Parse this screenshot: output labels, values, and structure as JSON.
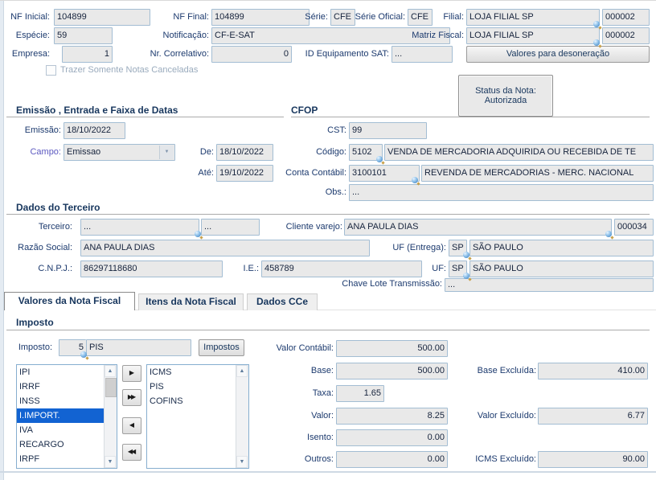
{
  "colors": {
    "label": "#1c3a6e",
    "field_bg": "#e9e9e9",
    "field_border": "#a3bdd3",
    "selection_blue": "#1263d2",
    "disabled_text": "#9aabbd"
  },
  "top": {
    "nf_inicial": {
      "label": "NF Inicial:",
      "value": "104899"
    },
    "nf_final": {
      "label": "NF Final:",
      "value": "104899"
    },
    "serie": {
      "label": "Série:",
      "value": "CFE"
    },
    "serie_oficial": {
      "label": "Série Oficial:",
      "value": "CFE"
    },
    "filial": {
      "label": "Filial:",
      "name": "LOJA FILIAL SP",
      "code": "000002"
    },
    "especie": {
      "label": "Espécie:",
      "value": "59"
    },
    "notificacao": {
      "label": "Notificação:",
      "value": "CF-E-SAT"
    },
    "matriz_fiscal": {
      "label": "Matriz Fiscal:",
      "name": "LOJA FILIAL SP",
      "code": "000002"
    },
    "empresa": {
      "label": "Empresa:",
      "value": "1"
    },
    "nr_correlativo": {
      "label": "Nr. Correlativo:",
      "value": "0"
    },
    "id_equipamento_sat": {
      "label": "ID Equipamento SAT:",
      "value": "..."
    },
    "desoneracao_button": "Valores para desoneração",
    "trazer_checkbox": "Trazer Somente Notas Canceladas",
    "status_panel": {
      "line1": "Status da Nota:",
      "line2": "Autorizada"
    }
  },
  "datas": {
    "title": "Emissão , Entrada e Faixa de Datas",
    "emissao": {
      "label": "Emissão:",
      "value": "18/10/2022"
    },
    "campo": {
      "label": "Campo:",
      "value": "Emissao"
    },
    "de": {
      "label": "De:",
      "value": "18/10/2022"
    },
    "ate": {
      "label": "Até:",
      "value": "19/10/2022"
    }
  },
  "cfop": {
    "title": "CFOP",
    "cst": {
      "label": "CST:",
      "value": "99"
    },
    "codigo": {
      "label": "Código:",
      "code": "5102",
      "desc": "VENDA DE MERCADORIA ADQUIRIDA OU RECEBIDA DE TE"
    },
    "conta_contabil": {
      "label": "Conta Contábil:",
      "code": "3100101",
      "desc": "REVENDA DE MERCADORIAS - MERC. NACIONAL"
    },
    "obs": {
      "label": "Obs.:",
      "value": "..."
    }
  },
  "terceiro": {
    "title": "Dados do Terceiro",
    "terceiro": {
      "label": "Terceiro:",
      "value1": "...",
      "value2": "..."
    },
    "cliente_varejo": {
      "label": "Cliente varejo:",
      "name": "ANA PAULA DIAS",
      "code": "000034"
    },
    "razao_social": {
      "label": "Razão Social:",
      "value": "ANA PAULA DIAS"
    },
    "uf_entrega": {
      "label": "UF (Entrega):",
      "uf": "SP",
      "nome": "SÃO PAULO"
    },
    "cnpj": {
      "label": "C.N.P.J.:",
      "value": "86297118680"
    },
    "ie": {
      "label": "I.E.:",
      "value": "458789"
    },
    "uf": {
      "label": "UF:",
      "uf": "SP",
      "nome": "SÃO PAULO"
    },
    "chave_lote": {
      "label": "Chave Lote Transmissão:",
      "value": "..."
    }
  },
  "tabs": {
    "valores": "Valores da Nota Fiscal",
    "itens": "Itens da Nota Fiscal",
    "dados_cce": "Dados CCe"
  },
  "imposto": {
    "title": "Imposto",
    "imposto_label": "Imposto:",
    "imposto_code": "5",
    "imposto_desc": "PIS",
    "impostos_button": "Impostos",
    "available": [
      "IPI",
      "IRRF",
      "INSS",
      "I.IMPORT.",
      "IVA",
      "RECARGO",
      "IRPF"
    ],
    "selected_item": "I.IMPORT.",
    "assigned": [
      "ICMS",
      "PIS",
      "COFINS"
    ],
    "valor_contabil": {
      "label": "Valor Contábil:",
      "value": "500.00"
    },
    "base": {
      "label": "Base:",
      "value": "500.00"
    },
    "taxa": {
      "label": "Taxa:",
      "value": "1.65"
    },
    "valor": {
      "label": "Valor:",
      "value": "8.25"
    },
    "isento": {
      "label": "Isento:",
      "value": "0.00"
    },
    "outros": {
      "label": "Outros:",
      "value": "0.00"
    },
    "base_excluida": {
      "label": "Base Excluída:",
      "value": "410.00"
    },
    "valor_excluido": {
      "label": "Valor Excluído:",
      "value": "6.77"
    },
    "icms_excluido": {
      "label": "ICMS Excluído:",
      "value": "90.00"
    }
  },
  "icons": {
    "move_right": "▶",
    "move_all_right": "▶▶",
    "move_left": "◀",
    "move_all_left": "◀◀",
    "scroll_up": "▲",
    "scroll_down": "▼",
    "dropdown": "▼"
  }
}
